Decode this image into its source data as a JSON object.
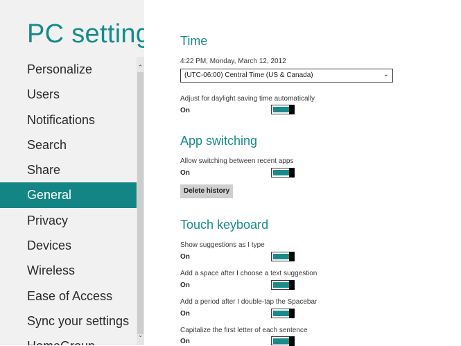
{
  "nav": {
    "title": "PC settings",
    "items": [
      {
        "label": "Personalize"
      },
      {
        "label": "Users"
      },
      {
        "label": "Notifications"
      },
      {
        "label": "Search"
      },
      {
        "label": "Share"
      },
      {
        "label": "General",
        "active": true
      },
      {
        "label": "Privacy"
      },
      {
        "label": "Devices"
      },
      {
        "label": "Wireless"
      },
      {
        "label": "Ease of Access"
      },
      {
        "label": "Sync your settings"
      },
      {
        "label": "HomeGroup"
      }
    ],
    "scroll_up_icon": "chevron-up-icon",
    "scroll_down_icon": "chevron-down-icon"
  },
  "time": {
    "heading": "Time",
    "current": "4:22 PM, Monday, March 12, 2012",
    "timezone": "(UTC-06:00) Central Time (US & Canada)",
    "dst_label": "Adjust for daylight saving time automatically",
    "dst_state": "On"
  },
  "app_switching": {
    "heading": "App switching",
    "allow_label": "Allow switching between recent apps",
    "allow_state": "On",
    "delete_button": "Delete history"
  },
  "touch_keyboard": {
    "heading": "Touch keyboard",
    "settings": [
      {
        "label": "Show suggestions as I type",
        "state": "On"
      },
      {
        "label": "Add a space after I choose a text suggestion",
        "state": "On"
      },
      {
        "label": "Add a period after I double-tap the Spacebar",
        "state": "On"
      },
      {
        "label": "Capitalize the first letter of each sentence",
        "state": "On"
      }
    ]
  },
  "colors": {
    "accent": "#168a8a",
    "nav_selected_bg": "#148585",
    "toggle_fill": "#1a8b8b",
    "nav_bg": "#f1f1f1"
  }
}
